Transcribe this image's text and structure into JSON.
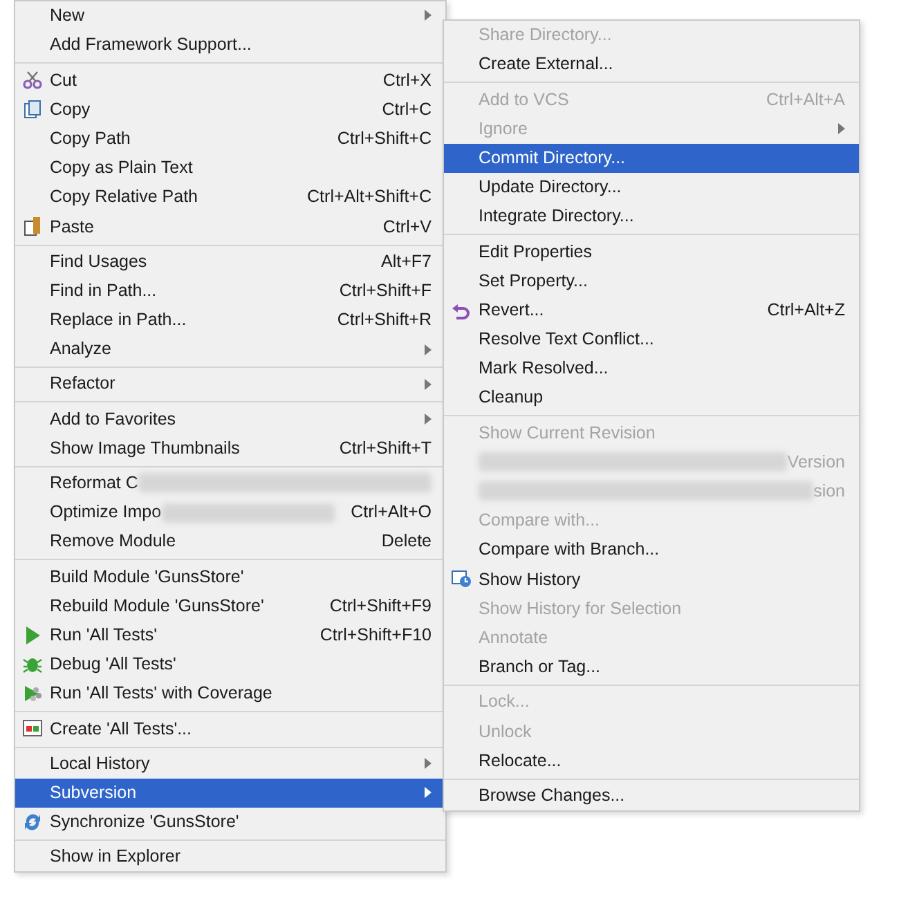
{
  "context_menu": {
    "items": [
      {
        "kind": "item",
        "label": "New",
        "submenu": true,
        "disabled": false,
        "selected": false
      },
      {
        "kind": "item",
        "label": "Add Framework Support...",
        "submenu": false,
        "disabled": false,
        "selected": false
      },
      {
        "kind": "separator"
      },
      {
        "kind": "cut",
        "label": "Cut",
        "shortcut": "Ctrl+X",
        "submenu": false,
        "disabled": false,
        "selected": false
      },
      {
        "kind": "copy",
        "label": "Copy",
        "shortcut": "Ctrl+C",
        "submenu": false,
        "disabled": false,
        "selected": false
      },
      {
        "kind": "item",
        "label": "Copy Path",
        "shortcut": "Ctrl+Shift+C",
        "submenu": false,
        "disabled": false,
        "selected": false
      },
      {
        "kind": "item",
        "label": "Copy as Plain Text",
        "submenu": false,
        "disabled": false,
        "selected": false
      },
      {
        "kind": "item",
        "label": "Copy Relative Path",
        "shortcut": "Ctrl+Alt+Shift+C",
        "submenu": false,
        "disabled": false,
        "selected": false
      },
      {
        "kind": "paste",
        "label": "Paste",
        "shortcut": "Ctrl+V",
        "submenu": false,
        "disabled": false,
        "selected": false
      },
      {
        "kind": "separator"
      },
      {
        "kind": "item",
        "label": "Find Usages",
        "shortcut": "Alt+F7",
        "submenu": false,
        "disabled": false,
        "selected": false
      },
      {
        "kind": "item",
        "label": "Find in Path...",
        "shortcut": "Ctrl+Shift+F",
        "submenu": false,
        "disabled": false,
        "selected": false
      },
      {
        "kind": "item",
        "label": "Replace in Path...",
        "shortcut": "Ctrl+Shift+R",
        "submenu": false,
        "disabled": false,
        "selected": false
      },
      {
        "kind": "item",
        "label": "Analyze",
        "submenu": true,
        "disabled": false,
        "selected": false
      },
      {
        "kind": "separator"
      },
      {
        "kind": "item",
        "label": "Refactor",
        "submenu": true,
        "disabled": false,
        "selected": false
      },
      {
        "kind": "separator"
      },
      {
        "kind": "item",
        "label": "Add to Favorites",
        "submenu": true,
        "disabled": false,
        "selected": false
      },
      {
        "kind": "item",
        "label": "Show Image Thumbnails",
        "shortcut": "Ctrl+Shift+T",
        "submenu": false,
        "disabled": false,
        "selected": false
      },
      {
        "kind": "separator"
      },
      {
        "kind": "obscured",
        "label": "Reformat C",
        "disabled": false
      },
      {
        "kind": "obscured",
        "label": "Optimize Impo",
        "shortcut": "Ctrl+Alt+O",
        "disabled": false
      },
      {
        "kind": "item",
        "label": "Remove Module",
        "shortcut": "Delete",
        "submenu": false,
        "disabled": false,
        "selected": false
      },
      {
        "kind": "separator"
      },
      {
        "kind": "item",
        "label": "Build Module 'GunsStore'",
        "submenu": false,
        "disabled": false,
        "selected": false
      },
      {
        "kind": "item",
        "label": "Rebuild Module 'GunsStore'",
        "shortcut": "Ctrl+Shift+F9",
        "submenu": false,
        "disabled": false,
        "selected": false
      },
      {
        "kind": "run",
        "label": "Run 'All Tests'",
        "shortcut": "Ctrl+Shift+F10",
        "submenu": false,
        "disabled": false,
        "selected": false
      },
      {
        "kind": "debug",
        "label": "Debug 'All Tests'",
        "submenu": false,
        "disabled": false,
        "selected": false
      },
      {
        "kind": "coverage",
        "label": "Run 'All Tests' with Coverage",
        "submenu": false,
        "disabled": false,
        "selected": false
      },
      {
        "kind": "separator"
      },
      {
        "kind": "create",
        "label": "Create 'All Tests'...",
        "submenu": false,
        "disabled": false,
        "selected": false
      },
      {
        "kind": "separator"
      },
      {
        "kind": "item",
        "label": "Local History",
        "submenu": true,
        "disabled": false,
        "selected": false
      },
      {
        "kind": "item",
        "label": "Subversion",
        "submenu": true,
        "disabled": false,
        "selected": true
      },
      {
        "kind": "sync",
        "label": "Synchronize 'GunsStore'",
        "submenu": false,
        "disabled": false,
        "selected": false
      },
      {
        "kind": "separator"
      },
      {
        "kind": "item",
        "label": "Show in Explorer",
        "submenu": false,
        "disabled": false,
        "selected": false
      }
    ]
  },
  "subversion_menu": {
    "items": [
      {
        "kind": "item",
        "label": "Share Directory...",
        "submenu": false,
        "disabled": true,
        "selected": false
      },
      {
        "kind": "item",
        "label": "Create External...",
        "submenu": false,
        "disabled": false,
        "selected": false
      },
      {
        "kind": "separator"
      },
      {
        "kind": "item",
        "label": "Add to VCS",
        "shortcut": "Ctrl+Alt+A",
        "submenu": false,
        "disabled": true,
        "selected": false
      },
      {
        "kind": "item",
        "label": "Ignore",
        "submenu": true,
        "disabled": true,
        "selected": false
      },
      {
        "kind": "item",
        "label": "Commit Directory...",
        "submenu": false,
        "disabled": false,
        "selected": true
      },
      {
        "kind": "item",
        "label": "Update Directory...",
        "submenu": false,
        "disabled": false,
        "selected": false
      },
      {
        "kind": "item",
        "label": "Integrate Directory...",
        "submenu": false,
        "disabled": false,
        "selected": false
      },
      {
        "kind": "separator"
      },
      {
        "kind": "item",
        "label": "Edit Properties",
        "submenu": false,
        "disabled": false,
        "selected": false
      },
      {
        "kind": "item",
        "label": "Set Property...",
        "submenu": false,
        "disabled": false,
        "selected": false
      },
      {
        "kind": "revert",
        "label": "Revert...",
        "shortcut": "Ctrl+Alt+Z",
        "submenu": false,
        "disabled": false,
        "selected": false
      },
      {
        "kind": "item",
        "label": "Resolve Text Conflict...",
        "submenu": false,
        "disabled": false,
        "selected": false
      },
      {
        "kind": "item",
        "label": "Mark Resolved...",
        "submenu": false,
        "disabled": false,
        "selected": false
      },
      {
        "kind": "item",
        "label": "Cleanup",
        "submenu": false,
        "disabled": false,
        "selected": false
      },
      {
        "kind": "separator"
      },
      {
        "kind": "item",
        "label": "Show Current Revision",
        "submenu": false,
        "disabled": true,
        "selected": false
      },
      {
        "kind": "obscured",
        "tail": "Version",
        "disabled": true
      },
      {
        "kind": "obscured",
        "tail": "sion",
        "disabled": true
      },
      {
        "kind": "item",
        "label": "Compare with...",
        "submenu": false,
        "disabled": true,
        "selected": false
      },
      {
        "kind": "item",
        "label": "Compare with Branch...",
        "submenu": false,
        "disabled": false,
        "selected": false
      },
      {
        "kind": "history",
        "label": "Show History",
        "submenu": false,
        "disabled": false,
        "selected": false
      },
      {
        "kind": "item",
        "label": "Show History for Selection",
        "submenu": false,
        "disabled": true,
        "selected": false
      },
      {
        "kind": "item",
        "label": "Annotate",
        "submenu": false,
        "disabled": true,
        "selected": false
      },
      {
        "kind": "item",
        "label": "Branch or Tag...",
        "submenu": false,
        "disabled": false,
        "selected": false
      },
      {
        "kind": "separator"
      },
      {
        "kind": "item",
        "label": "Lock...",
        "submenu": false,
        "disabled": true,
        "selected": false
      },
      {
        "kind": "item",
        "label": "Unlock",
        "submenu": false,
        "disabled": true,
        "selected": false
      },
      {
        "kind": "item",
        "label": "Relocate...",
        "submenu": false,
        "disabled": false,
        "selected": false
      },
      {
        "kind": "separator"
      },
      {
        "kind": "item",
        "label": "Browse Changes...",
        "submenu": false,
        "disabled": false,
        "selected": false
      }
    ]
  }
}
